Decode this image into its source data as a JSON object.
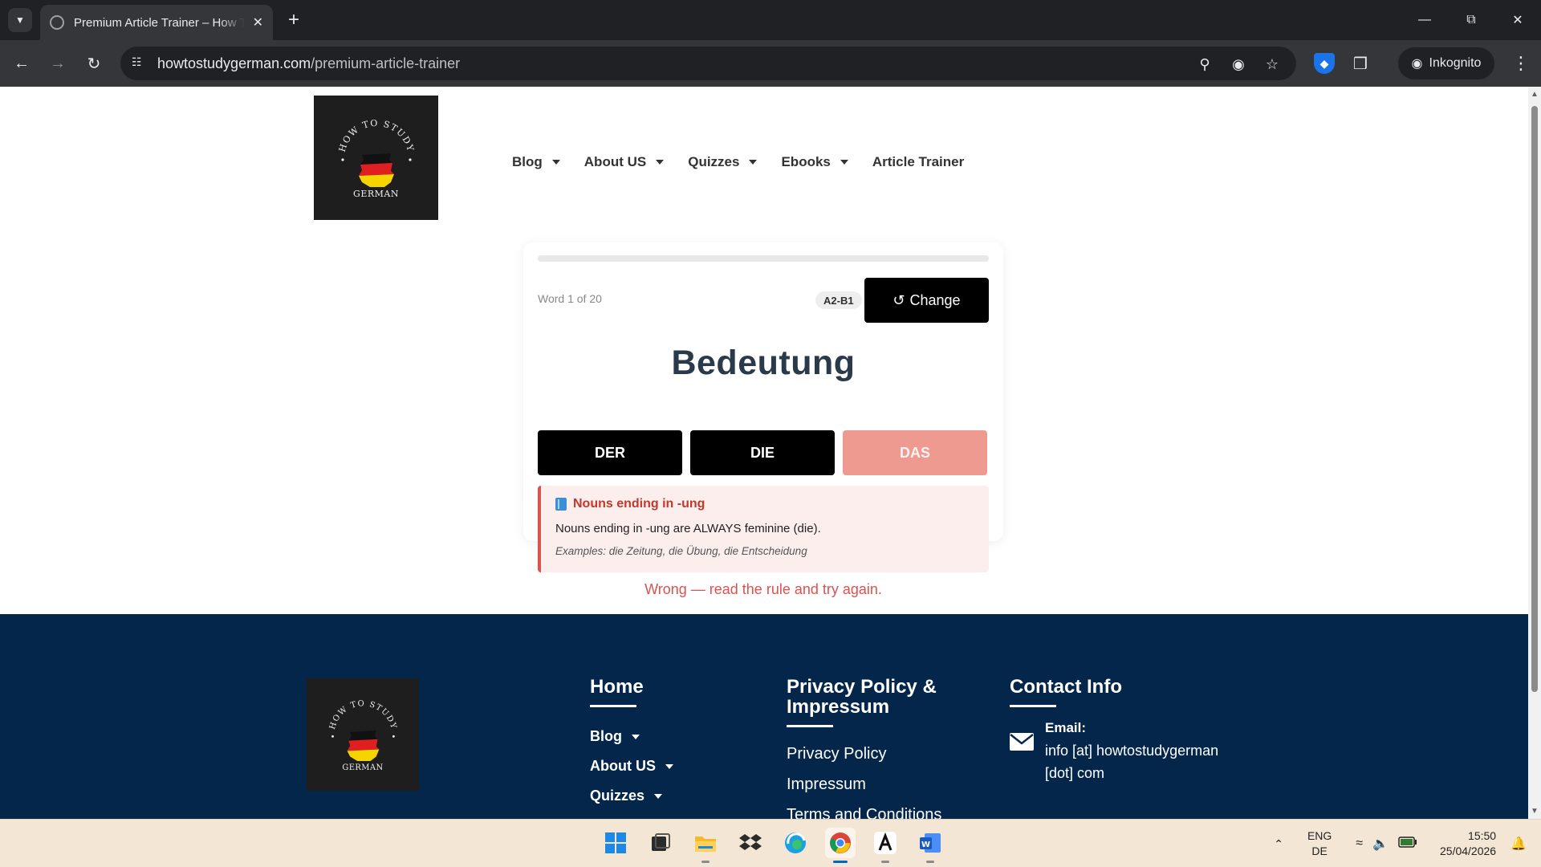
{
  "browser": {
    "tab_title": "Premium Article Trainer – How To Study German",
    "url_host": "howtostudygerman.com",
    "url_path": "/premium-article-trainer",
    "profile_label": "Inkognito"
  },
  "site": {
    "logo": {
      "top_text": "HOW TO STUDY",
      "bottom_text": "GERMAN"
    },
    "nav": [
      {
        "label": "Blog",
        "has_dropdown": true
      },
      {
        "label": "About US",
        "has_dropdown": true
      },
      {
        "label": "Quizzes",
        "has_dropdown": true
      },
      {
        "label": "Ebooks",
        "has_dropdown": true
      },
      {
        "label": "Article Trainer",
        "has_dropdown": false
      }
    ]
  },
  "trainer": {
    "progress_fraction": 0.0,
    "word_counter": "Word 1 of 20",
    "level": "A2-B1",
    "change_button": "Change",
    "word": "Bedeutung",
    "articles": [
      "DER",
      "DIE",
      "DAS"
    ],
    "wrong_choice": "DAS",
    "rule": {
      "title": "Nouns ending in -ung",
      "text": "Nouns ending in -ung are ALWAYS feminine (die).",
      "examples": "Examples: die Zeitung, die Übung, die Entscheidung"
    },
    "feedback": "Wrong — read the rule and try again."
  },
  "footer": {
    "home": {
      "heading": "Home",
      "links": [
        {
          "label": "Blog"
        },
        {
          "label": "About US"
        },
        {
          "label": "Quizzes"
        }
      ]
    },
    "privacy": {
      "heading": "Privacy Policy & Impressum",
      "links": [
        "Privacy Policy",
        "Impressum",
        "Terms and Conditions"
      ]
    },
    "contact": {
      "heading": "Contact Info",
      "email_label": "Email:",
      "email_value": "info [at] howtostudygerman [dot] com"
    }
  },
  "taskbar": {
    "lang_primary": "ENG",
    "lang_secondary": "DE",
    "time": "15:50",
    "date": "25/04/2026"
  },
  "colors": {
    "footer_bg": "#03264a",
    "wrong_button": "#ef9a90",
    "error_red": "#d9534f",
    "rule_bg": "#fdeeee",
    "word_color": "#2b3a4a"
  }
}
